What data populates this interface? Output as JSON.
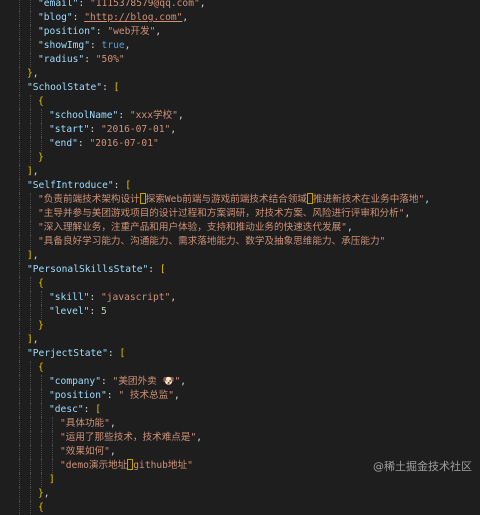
{
  "code_lines": [
    {
      "indent": 2,
      "segs": [
        [
          "k",
          "\"email\""
        ],
        [
          "p",
          ": "
        ],
        [
          "s",
          "\"1115378579@qq.com\""
        ],
        [
          "p",
          ","
        ]
      ]
    },
    {
      "indent": 2,
      "segs": [
        [
          "k",
          "\"blog\""
        ],
        [
          "p",
          ": "
        ],
        [
          "u",
          "\"http://blog.com\""
        ],
        [
          "p",
          ","
        ]
      ]
    },
    {
      "indent": 2,
      "segs": [
        [
          "k",
          "\"position\""
        ],
        [
          "p",
          ": "
        ],
        [
          "s",
          "\"web开发\""
        ],
        [
          "p",
          ","
        ]
      ]
    },
    {
      "indent": 2,
      "segs": [
        [
          "k",
          "\"showImg\""
        ],
        [
          "p",
          ": "
        ],
        [
          "b",
          "true"
        ],
        [
          "p",
          ","
        ]
      ]
    },
    {
      "indent": 2,
      "segs": [
        [
          "k",
          "\"radius\""
        ],
        [
          "p",
          ": "
        ],
        [
          "s",
          "\"50%\""
        ]
      ]
    },
    {
      "indent": 1,
      "segs": [
        [
          "y",
          "}"
        ],
        [
          "p",
          ","
        ]
      ]
    },
    {
      "indent": 1,
      "segs": [
        [
          "k",
          "\"SchoolState\""
        ],
        [
          "p",
          ": "
        ],
        [
          "y",
          "["
        ]
      ]
    },
    {
      "indent": 2,
      "segs": [
        [
          "y",
          "{"
        ]
      ]
    },
    {
      "indent": 3,
      "segs": [
        [
          "k",
          "\"schoolName\""
        ],
        [
          "p",
          ": "
        ],
        [
          "s",
          "\"xxx学校\""
        ],
        [
          "p",
          ","
        ]
      ]
    },
    {
      "indent": 3,
      "segs": [
        [
          "k",
          "\"start\""
        ],
        [
          "p",
          ": "
        ],
        [
          "s",
          "\"2016-07-01\""
        ],
        [
          "p",
          ","
        ]
      ]
    },
    {
      "indent": 3,
      "segs": [
        [
          "k",
          "\"end\""
        ],
        [
          "p",
          ": "
        ],
        [
          "s",
          "\"2016-07-01\""
        ]
      ]
    },
    {
      "indent": 2,
      "segs": [
        [
          "y",
          "}"
        ]
      ]
    },
    {
      "indent": 1,
      "segs": [
        [
          "y",
          "]"
        ],
        [
          "p",
          ","
        ]
      ]
    },
    {
      "indent": 1,
      "segs": [
        [
          "k",
          "\"SelfIntroduce\""
        ],
        [
          "p",
          ": "
        ],
        [
          "y",
          "["
        ]
      ]
    },
    {
      "indent": 2,
      "segs": [
        [
          "s",
          "\"负责前端技术架构设计"
        ],
        [
          "box",
          ""
        ],
        [
          "s",
          "探索Web前端与游戏前端技术结合领域"
        ],
        [
          "box",
          ""
        ],
        [
          "s",
          "推进新技术在业务中落地\""
        ],
        [
          "p",
          ","
        ]
      ]
    },
    {
      "indent": 2,
      "segs": [
        [
          "s",
          "\"主导并参与美团游戏项目的设计过程和方案调研，对技术方案、风险进行评审和分析\""
        ],
        [
          "p",
          ","
        ]
      ]
    },
    {
      "indent": 2,
      "segs": [
        [
          "s",
          "\"深入理解业务，注重产品和用户体验，支持和推动业务的快速迭代发展\""
        ],
        [
          "p",
          ","
        ]
      ]
    },
    {
      "indent": 2,
      "segs": [
        [
          "s",
          "\"具备良好学习能力、沟通能力、需求落地能力、数学及抽象思维能力、承压能力\""
        ]
      ]
    },
    {
      "indent": 1,
      "segs": [
        [
          "y",
          "]"
        ],
        [
          "p",
          ","
        ]
      ]
    },
    {
      "indent": 1,
      "segs": [
        [
          "k",
          "\"PersonalSkillsState\""
        ],
        [
          "p",
          ": "
        ],
        [
          "y",
          "["
        ]
      ]
    },
    {
      "indent": 2,
      "segs": [
        [
          "y",
          "{"
        ]
      ]
    },
    {
      "indent": 3,
      "segs": [
        [
          "k",
          "\"skill\""
        ],
        [
          "p",
          ": "
        ],
        [
          "s",
          "\"javascript\""
        ],
        [
          "p",
          ","
        ]
      ]
    },
    {
      "indent": 3,
      "segs": [
        [
          "k",
          "\"level\""
        ],
        [
          "p",
          ": "
        ],
        [
          "n",
          "5"
        ]
      ]
    },
    {
      "indent": 2,
      "segs": [
        [
          "y",
          "}"
        ]
      ]
    },
    {
      "indent": 1,
      "segs": [
        [
          "y",
          "]"
        ],
        [
          "p",
          ","
        ]
      ]
    },
    {
      "indent": 1,
      "segs": [
        [
          "k",
          "\"PerjectState\""
        ],
        [
          "p",
          ": "
        ],
        [
          "y",
          "["
        ]
      ]
    },
    {
      "indent": 2,
      "segs": [
        [
          "y",
          "{"
        ]
      ]
    },
    {
      "indent": 3,
      "segs": [
        [
          "k",
          "\"company\""
        ],
        [
          "p",
          ": "
        ],
        [
          "s",
          "\"美团外卖 "
        ],
        [
          "emoji",
          "🐶"
        ],
        [
          "s",
          "\""
        ],
        [
          "p",
          ","
        ]
      ]
    },
    {
      "indent": 3,
      "segs": [
        [
          "k",
          "\"position\""
        ],
        [
          "p",
          ": "
        ],
        [
          "s",
          "\" 技术总监\""
        ],
        [
          "p",
          ","
        ]
      ]
    },
    {
      "indent": 3,
      "segs": [
        [
          "k",
          "\"desc\""
        ],
        [
          "p",
          ": "
        ],
        [
          "y",
          "["
        ]
      ]
    },
    {
      "indent": 4,
      "segs": [
        [
          "s",
          "\"具体功能\""
        ],
        [
          "p",
          ","
        ]
      ]
    },
    {
      "indent": 4,
      "segs": [
        [
          "s",
          "\"运用了那些技术，技术难点是\""
        ],
        [
          "p",
          ","
        ]
      ]
    },
    {
      "indent": 4,
      "segs": [
        [
          "s",
          "\"效果如何\""
        ],
        [
          "p",
          ","
        ]
      ]
    },
    {
      "indent": 4,
      "segs": [
        [
          "s",
          "\"demo演示地址"
        ],
        [
          "box",
          ""
        ],
        [
          "s",
          "github地址\""
        ]
      ]
    },
    {
      "indent": 3,
      "segs": [
        [
          "y",
          "]"
        ]
      ]
    },
    {
      "indent": 2,
      "segs": [
        [
          "y",
          "}"
        ],
        [
          "p",
          ","
        ]
      ]
    },
    {
      "indent": 2,
      "segs": [
        [
          "y",
          "{"
        ]
      ]
    }
  ],
  "watermark": "@稀土掘金技术社区"
}
